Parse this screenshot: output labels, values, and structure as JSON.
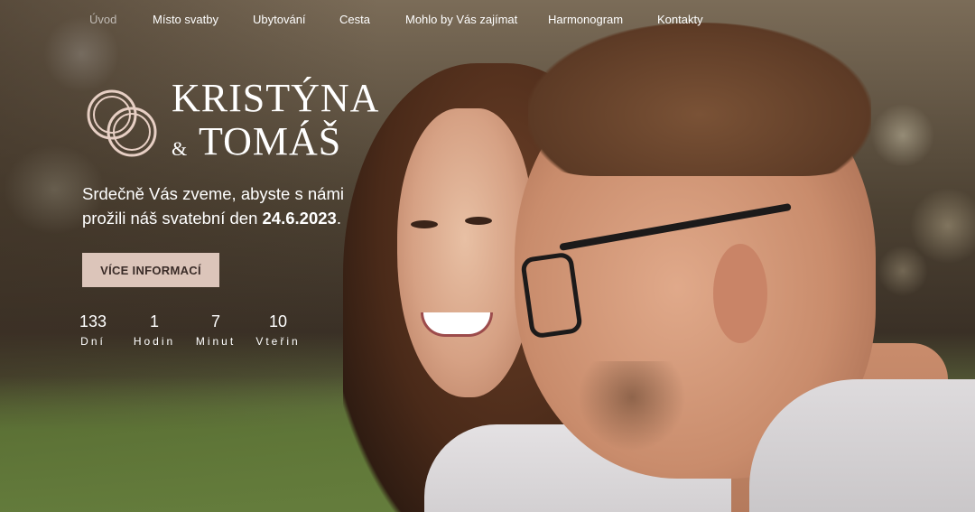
{
  "nav": {
    "items": [
      {
        "label": "Úvod",
        "active": true
      },
      {
        "label": "Místo svatby",
        "active": false
      },
      {
        "label": "Ubytování",
        "active": false
      },
      {
        "label": "Cesta",
        "active": false
      },
      {
        "label": "Mohlo by Vás zajímat",
        "active": false
      },
      {
        "label": "Harmonogram",
        "active": false
      },
      {
        "label": "Kontakty",
        "active": false
      }
    ]
  },
  "hero": {
    "name1": "KRISTÝNA",
    "ampersand": "&",
    "name2": "TOMÁŠ",
    "invite_line1": "Srdečně Vás zveme, abyste s námi",
    "invite_line2_prefix": "prožili náš svatební den ",
    "wedding_date": "24.6.2023",
    "invite_suffix": ".",
    "button_label": "VÍCE INFORMACÍ"
  },
  "countdown": [
    {
      "value": "133",
      "label": "Dní"
    },
    {
      "value": "1",
      "label": "Hodin"
    },
    {
      "value": "7",
      "label": "Minut"
    },
    {
      "value": "10",
      "label": "Vteřin"
    }
  ],
  "colors": {
    "accent": "#dcc5ba",
    "rings": "#e7cfc4",
    "text": "#ffffff"
  },
  "icons": {
    "logo": "wedding-rings-icon"
  }
}
